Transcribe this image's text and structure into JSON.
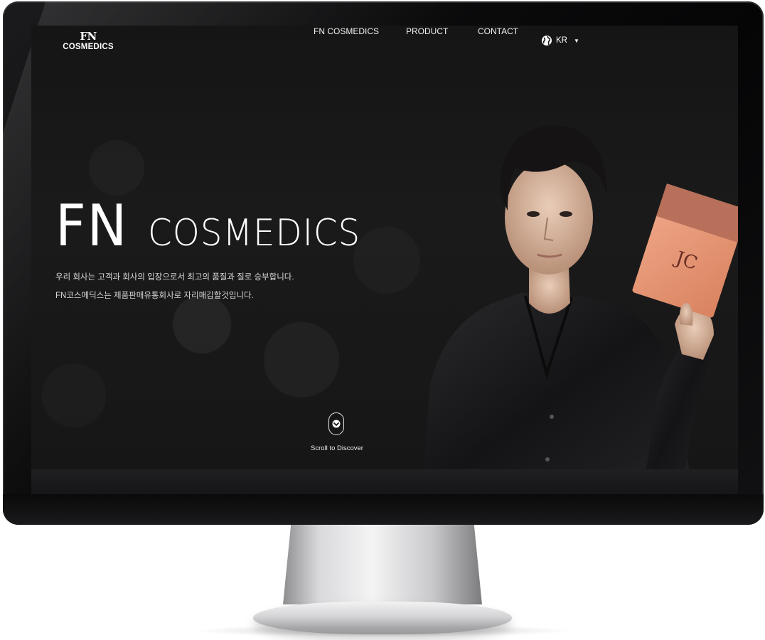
{
  "header": {
    "logo_mark": "FN",
    "logo_text": "COSMEDICS",
    "nav": [
      {
        "label": "FN COSMEDICS"
      },
      {
        "label": "PRODUCT"
      },
      {
        "label": "CONTACT"
      }
    ],
    "language": {
      "label": "KR",
      "icon": "globe-icon"
    }
  },
  "hero": {
    "title_part1": "FN",
    "title_part2": "COSMEDICS",
    "description_lines": [
      "우리 회사는 고객과 회사의 입장으로서 최고의 품질과 질로 승부합니다.",
      "FN코스메딕스는 제품판매유통회사로 자리매김할것입니다."
    ]
  },
  "scroll": {
    "label": "Scroll to Discover",
    "icon": "chevron-down-icon"
  },
  "product": {
    "brand_mark": "JC"
  },
  "colors": {
    "background": "#161616",
    "text": "#ffffff",
    "mask_pouch": "#e8987a",
    "bezel": "#0b0b0c"
  }
}
